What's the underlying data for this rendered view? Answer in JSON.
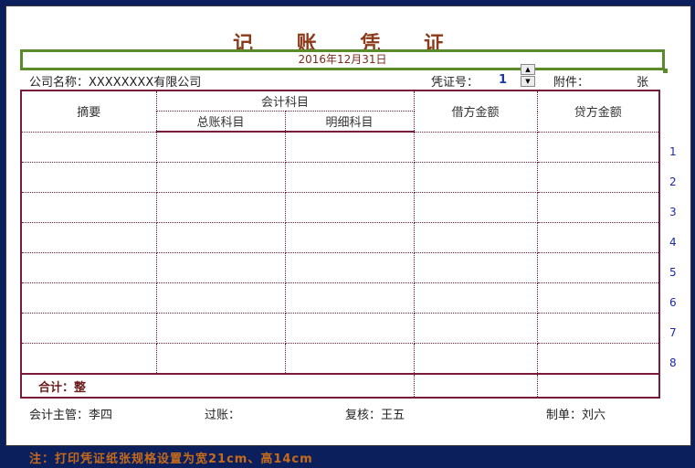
{
  "voucher": {
    "title": "记 账 凭 证",
    "date": "2016年12月31日",
    "company": "公司名称：XXXXXXXX有限公司",
    "voucher_no_label": "凭证号：",
    "voucher_no": "1",
    "attachment_label": "附件：",
    "attachment_unit": "张"
  },
  "table": {
    "headers": {
      "summary": "摘要",
      "account": "会计科目",
      "general_account": "总账科目",
      "detail_account": "明细科目",
      "debit": "借方金额",
      "credit": "贷方金额"
    },
    "row_numbers": [
      "1",
      "2",
      "3",
      "4",
      "5",
      "6",
      "7",
      "8"
    ],
    "total_label": "合计：整"
  },
  "signatures": {
    "supervisor": "会计主管：李四",
    "posting": "过账：",
    "review": "复核：王五",
    "preparer": "制单：刘六"
  },
  "footer_note": "注：打印凭证纸张规格设置为宽21cm、高14cm",
  "colors": {
    "background": "#0a1f5c",
    "title": "#8b3a1a",
    "table_border": "#7a1a3a",
    "date_border": "#5a8a2a",
    "note": "#c66a1a"
  }
}
